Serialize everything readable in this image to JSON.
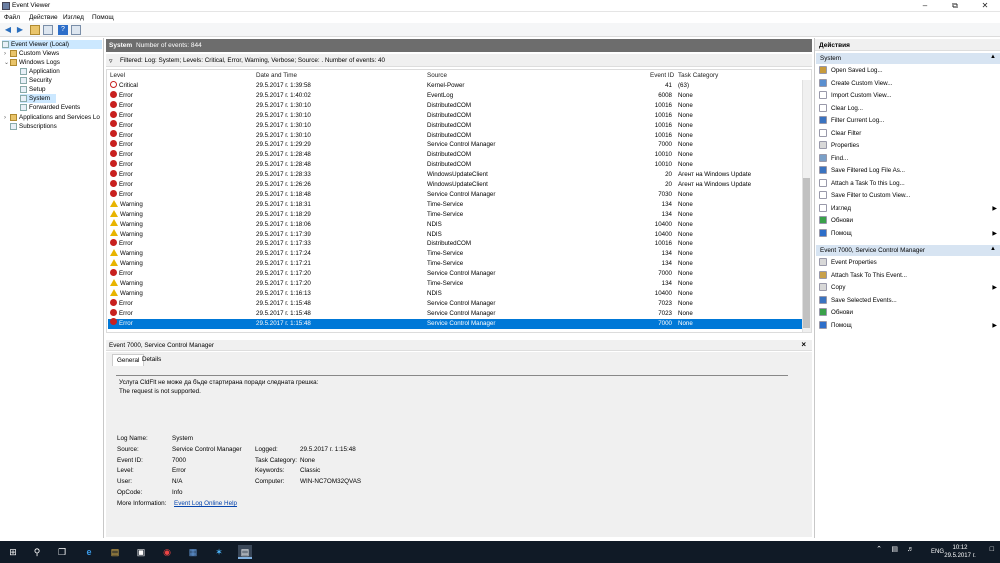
{
  "window": {
    "title": "Event Viewer"
  },
  "menu": [
    "Файл",
    "Действие",
    "Изглед",
    "Помощ"
  ],
  "tree": {
    "root": "Event Viewer (Local)",
    "items": [
      {
        "label": "Custom Views",
        "indent": 1
      },
      {
        "label": "Windows Logs",
        "indent": 1
      },
      {
        "label": "Application",
        "indent": 2
      },
      {
        "label": "Security",
        "indent": 2
      },
      {
        "label": "Setup",
        "indent": 2
      },
      {
        "label": "System",
        "indent": 2
      },
      {
        "label": "Forwarded Events",
        "indent": 2
      },
      {
        "label": "Applications and Services Lo",
        "indent": 1
      },
      {
        "label": "Subscriptions",
        "indent": 1
      }
    ]
  },
  "header": {
    "log": "System",
    "count": "Number of events: 844"
  },
  "filter": {
    "text": "Filtered: Log: System; Levels: Critical, Error, Warning, Verbose; Source: . Number of events: 40"
  },
  "columns": {
    "level": "Level",
    "datetime": "Date and Time",
    "source": "Source",
    "event_id": "Event ID",
    "task": "Task Category"
  },
  "events": [
    {
      "type": "crit",
      "level": "Critical",
      "dt": "29.5.2017 г. 1:39:58",
      "src": "Kernel-Power",
      "id": "41",
      "task": "(63)"
    },
    {
      "type": "err",
      "level": "Error",
      "dt": "29.5.2017 г. 1:40:02",
      "src": "EventLog",
      "id": "6008",
      "task": "None"
    },
    {
      "type": "err",
      "level": "Error",
      "dt": "29.5.2017 г. 1:30:10",
      "src": "DistributedCOM",
      "id": "10016",
      "task": "None"
    },
    {
      "type": "err",
      "level": "Error",
      "dt": "29.5.2017 г. 1:30:10",
      "src": "DistributedCOM",
      "id": "10016",
      "task": "None"
    },
    {
      "type": "err",
      "level": "Error",
      "dt": "29.5.2017 г. 1:30:10",
      "src": "DistributedCOM",
      "id": "10016",
      "task": "None"
    },
    {
      "type": "err",
      "level": "Error",
      "dt": "29.5.2017 г. 1:30:10",
      "src": "DistributedCOM",
      "id": "10016",
      "task": "None"
    },
    {
      "type": "err",
      "level": "Error",
      "dt": "29.5.2017 г. 1:29:29",
      "src": "Service Control Manager",
      "id": "7000",
      "task": "None"
    },
    {
      "type": "err",
      "level": "Error",
      "dt": "29.5.2017 г. 1:28:48",
      "src": "DistributedCOM",
      "id": "10010",
      "task": "None"
    },
    {
      "type": "err",
      "level": "Error",
      "dt": "29.5.2017 г. 1:28:48",
      "src": "DistributedCOM",
      "id": "10010",
      "task": "None"
    },
    {
      "type": "err",
      "level": "Error",
      "dt": "29.5.2017 г. 1:28:33",
      "src": "WindowsUpdateClient",
      "id": "20",
      "task": "Агент на Windows Update"
    },
    {
      "type": "err",
      "level": "Error",
      "dt": "29.5.2017 г. 1:26:26",
      "src": "WindowsUpdateClient",
      "id": "20",
      "task": "Агент на Windows Update"
    },
    {
      "type": "err",
      "level": "Error",
      "dt": "29.5.2017 г. 1:18:48",
      "src": "Service Control Manager",
      "id": "7030",
      "task": "None"
    },
    {
      "type": "warn",
      "level": "Warning",
      "dt": "29.5.2017 г. 1:18:31",
      "src": "Time-Service",
      "id": "134",
      "task": "None"
    },
    {
      "type": "warn",
      "level": "Warning",
      "dt": "29.5.2017 г. 1:18:29",
      "src": "Time-Service",
      "id": "134",
      "task": "None"
    },
    {
      "type": "warn",
      "level": "Warning",
      "dt": "29.5.2017 г. 1:18:06",
      "src": "NDIS",
      "id": "10400",
      "task": "None"
    },
    {
      "type": "warn",
      "level": "Warning",
      "dt": "29.5.2017 г. 1:17:39",
      "src": "NDIS",
      "id": "10400",
      "task": "None"
    },
    {
      "type": "err",
      "level": "Error",
      "dt": "29.5.2017 г. 1:17:33",
      "src": "DistributedCOM",
      "id": "10016",
      "task": "None"
    },
    {
      "type": "warn",
      "level": "Warning",
      "dt": "29.5.2017 г. 1:17:24",
      "src": "Time-Service",
      "id": "134",
      "task": "None"
    },
    {
      "type": "warn",
      "level": "Warning",
      "dt": "29.5.2017 г. 1:17:21",
      "src": "Time-Service",
      "id": "134",
      "task": "None"
    },
    {
      "type": "err",
      "level": "Error",
      "dt": "29.5.2017 г. 1:17:20",
      "src": "Service Control Manager",
      "id": "7000",
      "task": "None"
    },
    {
      "type": "warn",
      "level": "Warning",
      "dt": "29.5.2017 г. 1:17:20",
      "src": "Time-Service",
      "id": "134",
      "task": "None"
    },
    {
      "type": "warn",
      "level": "Warning",
      "dt": "29.5.2017 г. 1:16:13",
      "src": "NDIS",
      "id": "10400",
      "task": "None"
    },
    {
      "type": "err",
      "level": "Error",
      "dt": "29.5.2017 г. 1:15:48",
      "src": "Service Control Manager",
      "id": "7023",
      "task": "None"
    },
    {
      "type": "err",
      "level": "Error",
      "dt": "29.5.2017 г. 1:15:48",
      "src": "Service Control Manager",
      "id": "7023",
      "task": "None"
    },
    {
      "type": "err",
      "level": "Error",
      "dt": "29.5.2017 г. 1:15:48",
      "src": "Service Control Manager",
      "id": "7000",
      "task": "None",
      "selected": true
    }
  ],
  "detail": {
    "title": "Event 7000, Service Control Manager",
    "tabs": [
      "General",
      "Details"
    ],
    "message_line1": "Услуга CldFlt не може да бъде стартирана поради следната грешка:",
    "message_line2": "The request is not supported.",
    "fields_left": [
      {
        "k": "Log Name:",
        "v": "System"
      },
      {
        "k": "Source:",
        "v": "Service Control Manager"
      },
      {
        "k": "Event ID:",
        "v": "7000"
      },
      {
        "k": "Level:",
        "v": "Error"
      },
      {
        "k": "User:",
        "v": "N/A"
      },
      {
        "k": "OpCode:",
        "v": "Info"
      }
    ],
    "fields_right": [
      {
        "k": "Logged:",
        "v": "29.5.2017 г. 1:15:48"
      },
      {
        "k": "Task Category:",
        "v": "None"
      },
      {
        "k": "Keywords:",
        "v": "Classic"
      },
      {
        "k": "Computer:",
        "v": "WIN-NC7OM32QVAS"
      }
    ],
    "more_info_label": "More Information:",
    "more_info_link": "Event Log Online Help"
  },
  "actions": {
    "title": "Действия",
    "section1": "System",
    "items1": [
      {
        "label": "Open Saved Log...",
        "icon": "#c89b3c"
      },
      {
        "label": "Create Custom View...",
        "icon": "#5a8fd0"
      },
      {
        "label": "Import Custom View...",
        "icon": "#ffffff"
      },
      {
        "label": "Clear Log...",
        "icon": "#ffffff"
      },
      {
        "label": "Filter Current Log...",
        "icon": "#3a73c0"
      },
      {
        "label": "Clear Filter",
        "icon": "#ffffff"
      },
      {
        "label": "Properties",
        "icon": "#d8d8d8"
      },
      {
        "label": "Find...",
        "icon": "#7aa0c8"
      },
      {
        "label": "Save Filtered Log File As...",
        "icon": "#3a73c0"
      },
      {
        "label": "Attach a Task To this Log...",
        "icon": "#ffffff"
      },
      {
        "label": "Save Filter to Custom View...",
        "icon": "#ffffff"
      },
      {
        "label": "Изглед",
        "icon": "#ffffff",
        "arrow": true
      },
      {
        "label": "Обнови",
        "icon": "#3aa14a"
      },
      {
        "label": "Помощ",
        "icon": "#2d6ec9",
        "arrow": true
      }
    ],
    "section2": "Event 7000, Service Control Manager",
    "items2": [
      {
        "label": "Event Properties",
        "icon": "#d8d8d8"
      },
      {
        "label": "Attach Task To This Event...",
        "icon": "#c8a04a"
      },
      {
        "label": "Copy",
        "icon": "#d8d8d8",
        "arrow": true
      },
      {
        "label": "Save Selected Events...",
        "icon": "#3a73c0"
      },
      {
        "label": "Обнови",
        "icon": "#3aa14a"
      },
      {
        "label": "Помощ",
        "icon": "#2d6ec9",
        "arrow": true
      }
    ]
  },
  "taskbar": {
    "lang": "ENG",
    "time": "10:12",
    "date": "29.5.2017 г."
  }
}
